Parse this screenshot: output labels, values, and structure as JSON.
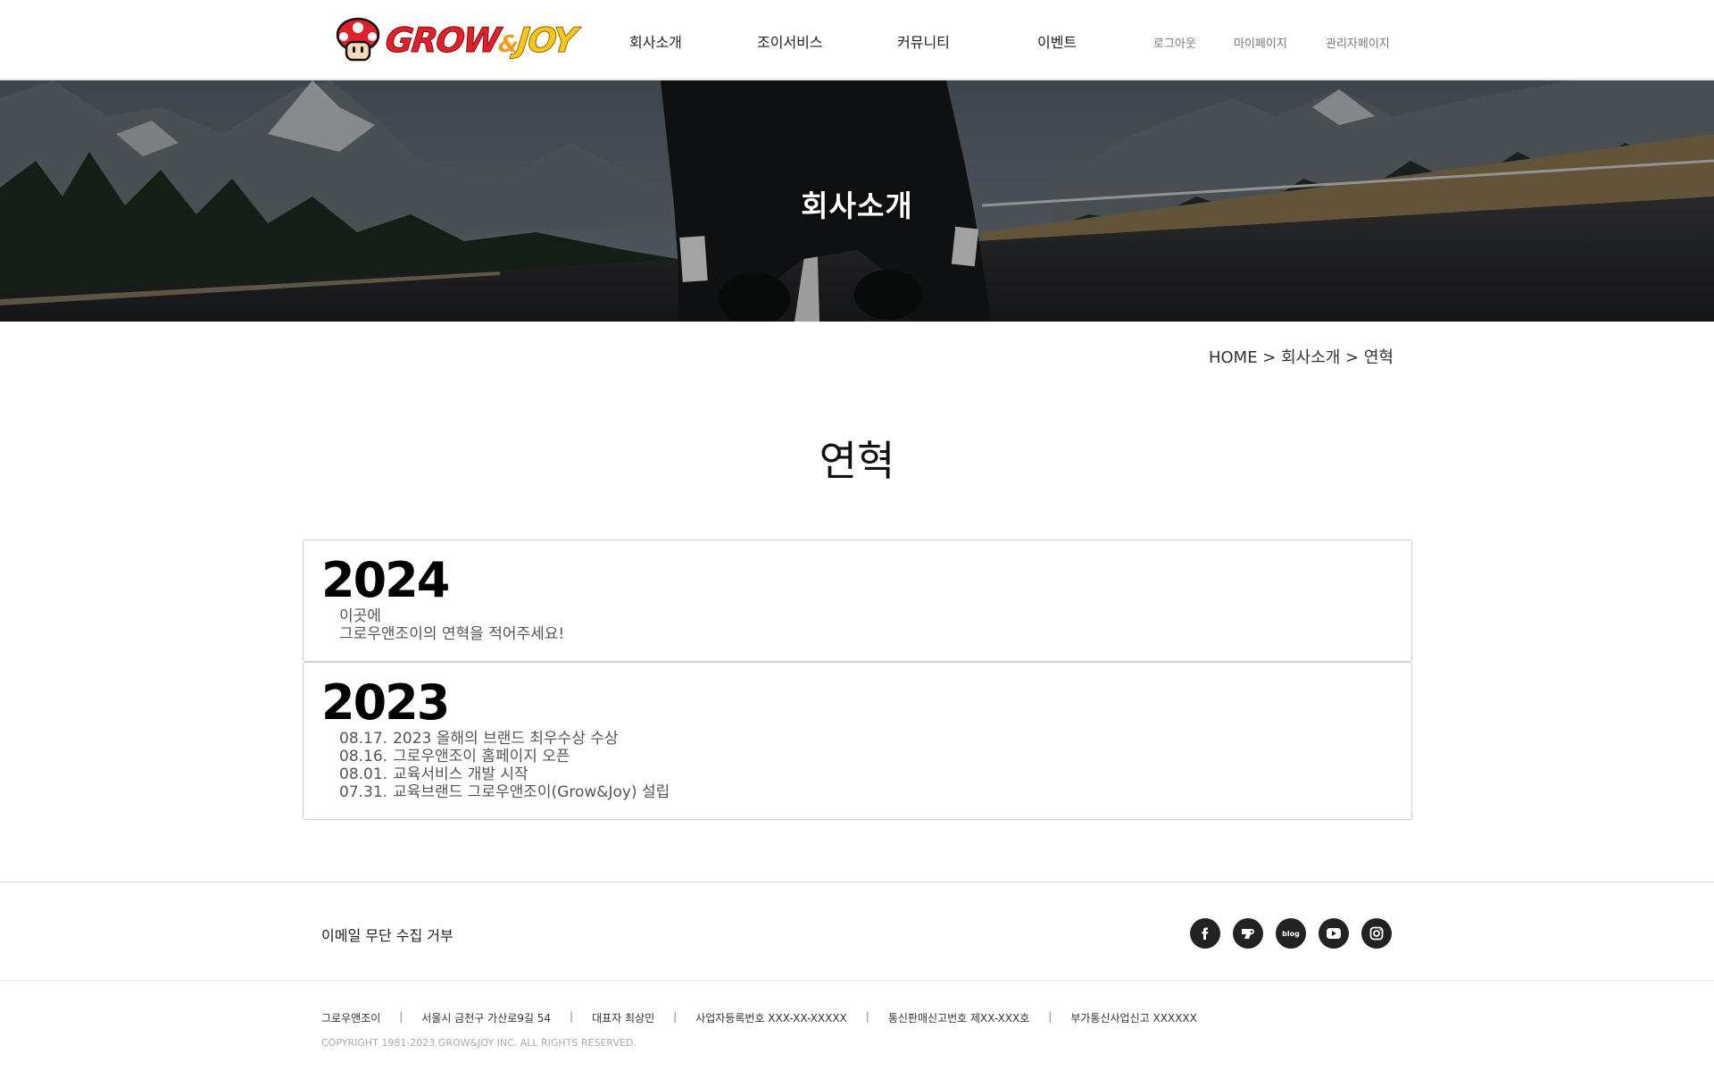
{
  "header": {
    "logo_text_main": "GROW",
    "logo_text_amp": "&",
    "logo_text_end": "JOY",
    "nav": [
      {
        "label": "회사소개"
      },
      {
        "label": "조이서비스"
      },
      {
        "label": "커뮤니티"
      },
      {
        "label": "이벤트"
      }
    ],
    "util": [
      {
        "label": "로그아웃"
      },
      {
        "label": "마이페이지"
      },
      {
        "label": "관리자페이지"
      }
    ]
  },
  "hero": {
    "title": "회사소개"
  },
  "breadcrumb": "HOME > 회사소개 > 연혁",
  "page_title": "연혁",
  "history": [
    {
      "year": "2024",
      "entries": [
        {
          "date": "",
          "text": "이곳에"
        },
        {
          "date": "",
          "text": "그로우앤조이의 연혁을 적어주세요!"
        }
      ]
    },
    {
      "year": "2023",
      "entries": [
        {
          "date": "08.17.",
          "text": "2023 올해의 브랜드 최우수상 수상"
        },
        {
          "date": "08.16.",
          "text": "그로우앤조이 홈페이지 오픈"
        },
        {
          "date": "08.01.",
          "text": "교육서비스 개발 시작"
        },
        {
          "date": "07.31.",
          "text": "교육브랜드 그로우앤조이(Grow&Joy) 설립"
        }
      ]
    }
  ],
  "footer": {
    "link": "이메일 무단 수집 거부",
    "social": [
      {
        "icon": "facebook-icon",
        "label": "f"
      },
      {
        "icon": "kakao-story-icon",
        "label": ""
      },
      {
        "icon": "blog-icon",
        "label": "blog"
      },
      {
        "icon": "youtube-icon",
        "label": ""
      },
      {
        "icon": "instagram-icon",
        "label": ""
      }
    ],
    "info": [
      "그로우앤조이",
      "서울시 금천구 가산로9길 54",
      "대표자 최상민",
      "사업자등록번호 XXX-XX-XXXXX",
      "통신판매신고번호 제XX-XXX호",
      "부가통신사업신고 XXXXXX"
    ],
    "separator": "|",
    "copyright": "COPYRIGHT 1981-2023 GROW&JOY INC. ALL RIGHTS RESERVED."
  },
  "colors": {
    "brand_red": "#e0202a",
    "brand_yellow": "#f7c51c",
    "brand_orange": "#f29a1a",
    "social_bg": "#222222"
  }
}
